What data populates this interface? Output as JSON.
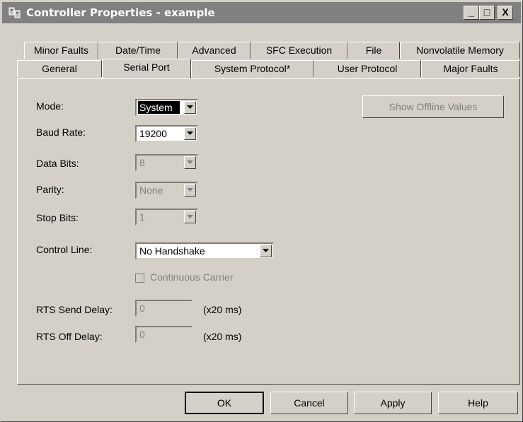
{
  "window": {
    "title": "Controller Properties - example",
    "controls": {
      "minimize": "_",
      "maximize": "□",
      "close": "X"
    }
  },
  "tabs": {
    "row1": [
      "Minor Faults",
      "Date/Time",
      "Advanced",
      "SFC Execution",
      "File",
      "Nonvolatile Memory"
    ],
    "row2": [
      "General",
      "Serial Port",
      "System Protocol*",
      "User Protocol",
      "Major Faults"
    ],
    "active": "Serial Port"
  },
  "form": {
    "mode": {
      "label": "Mode:",
      "value": "System"
    },
    "baud_rate": {
      "label": "Baud Rate:",
      "value": "19200"
    },
    "data_bits": {
      "label": "Data Bits:",
      "value": "8"
    },
    "parity": {
      "label": "Parity:",
      "value": "None"
    },
    "stop_bits": {
      "label": "Stop Bits:",
      "value": "1"
    },
    "control_line": {
      "label": "Control Line:",
      "value": "No Handshake"
    },
    "continuous_carrier": {
      "label": "Continuous Carrier",
      "checked": false
    },
    "rts_send_delay": {
      "label": "RTS Send Delay:",
      "value": "0",
      "unit": "(x20 ms)"
    },
    "rts_off_delay": {
      "label": "RTS Off Delay:",
      "value": "0",
      "unit": "(x20 ms)"
    },
    "show_offline": "Show Offline Values"
  },
  "buttons": {
    "ok": "OK",
    "cancel": "Cancel",
    "apply": "Apply",
    "help": "Help"
  },
  "colors": {
    "dialog_bg": "#d4d0c8",
    "titlebar": "#808080",
    "selection": "#000000"
  }
}
